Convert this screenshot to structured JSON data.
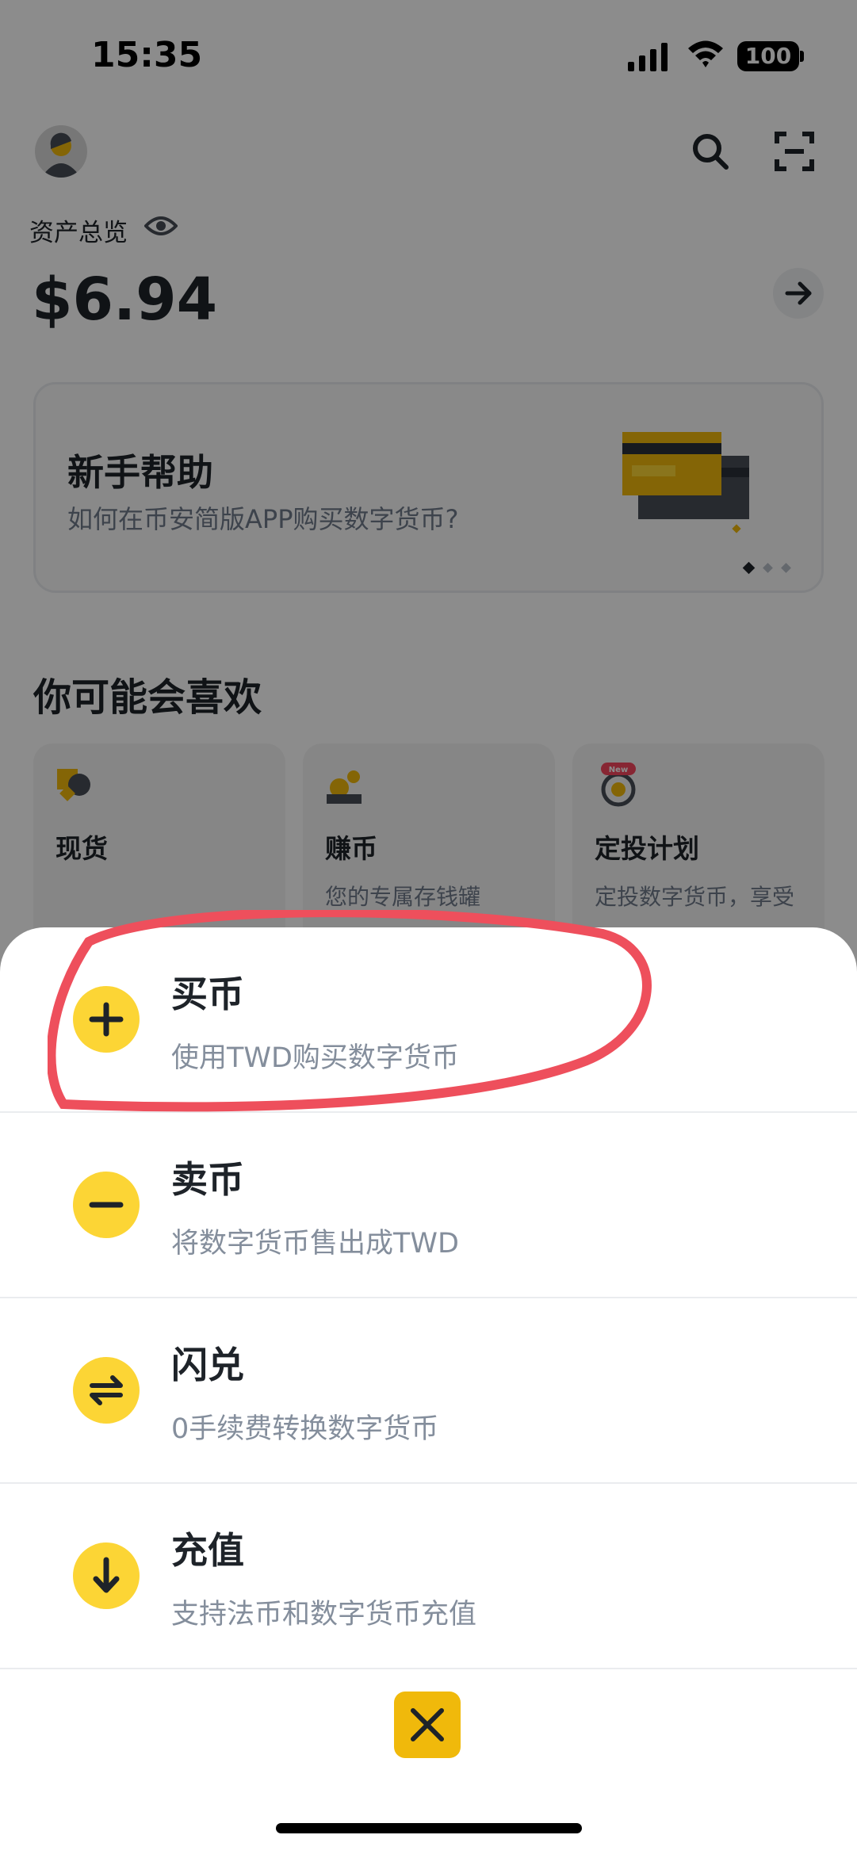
{
  "status_bar": {
    "time": "15:35",
    "battery": "100"
  },
  "home": {
    "asset_label": "资产总览",
    "asset_value": "$6.94",
    "help_card": {
      "title": "新手帮助",
      "subtitle": "如何在币安简版APP购买数字货币?"
    },
    "section_title": "你可能会喜欢",
    "recommendations": [
      {
        "title": "现货",
        "desc": "",
        "badge": ""
      },
      {
        "title": "赚币",
        "desc": "您的专属存钱罐",
        "badge": ""
      },
      {
        "title": "定投计划",
        "desc": "定投数字货币，享受",
        "badge": "New"
      }
    ]
  },
  "action_sheet": {
    "items": [
      {
        "title": "买币",
        "desc": "使用TWD购买数字货币",
        "icon": "plus-icon"
      },
      {
        "title": "卖币",
        "desc": "将数字货币售出成TWD",
        "icon": "minus-icon"
      },
      {
        "title": "闪兑",
        "desc": "0手续费转换数字货币",
        "icon": "swap-icon"
      },
      {
        "title": "充值",
        "desc": "支持法币和数字货币充值",
        "icon": "arrow-down-icon"
      }
    ],
    "close_icon": "close-icon"
  },
  "colors": {
    "brand_yellow": "#fcd535",
    "close_button": "#f0b90b",
    "highlight_annotation": "#ee4f5c",
    "text_primary": "#1e2329",
    "text_secondary": "#848e9c"
  }
}
